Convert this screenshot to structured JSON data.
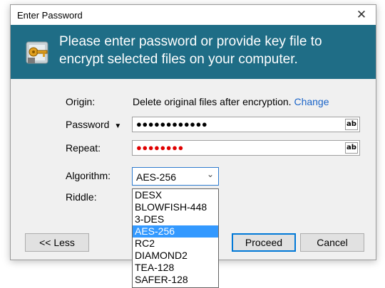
{
  "window": {
    "title": "Enter Password",
    "close_glyph": "✕"
  },
  "banner": {
    "icon": "keys-icon",
    "text": "Please enter password or provide key file to encrypt selected files on your computer."
  },
  "origin": {
    "label": "Origin:",
    "text": "Delete original files after encryption.",
    "link": "Change"
  },
  "password": {
    "label": "Password",
    "masked_value": "●●●●●●●●●●●●",
    "toggle": "ab",
    "value_color": "#000000"
  },
  "repeat": {
    "label": "Repeat:",
    "masked_value": "●●●●●●●●",
    "toggle": "ab",
    "value_color": "#e00000"
  },
  "algorithm": {
    "label": "Algorithm:",
    "selected": "AES-256",
    "options": [
      "DESX",
      "BLOWFISH-448",
      "3-DES",
      "AES-256",
      "RC2",
      "DIAMOND2",
      "TEA-128",
      "SAFER-128"
    ],
    "selected_index": 3
  },
  "riddle": {
    "label": "Riddle:"
  },
  "buttons": {
    "less": "<< Less",
    "proceed": "Proceed",
    "cancel": "Cancel"
  }
}
